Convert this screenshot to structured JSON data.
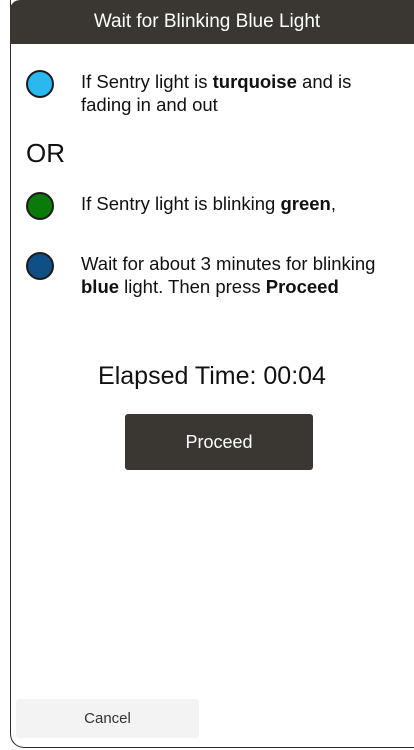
{
  "header": {
    "title": "Wait for Blinking Blue Light"
  },
  "options": [
    {
      "color": "#2bb8ee",
      "text_before": "If Sentry light is ",
      "text_bold": "turquoise",
      "text_after": " and is fading in and out"
    },
    {
      "color": "#0a7a0a",
      "text_before": "If Sentry light is blinking ",
      "text_bold": "green",
      "text_after": ","
    },
    {
      "color": "#0f4f85",
      "text_before": "Wait for about 3 minutes for blinking ",
      "text_bold": "blue",
      "text_after": " light. Then press ",
      "text_bold2": "Proceed"
    }
  ],
  "or_label": "OR",
  "elapsed": {
    "label": "Elapsed Time: 00:04"
  },
  "buttons": {
    "proceed": "Proceed",
    "cancel": "Cancel"
  },
  "colors": {
    "header_bg": "#3a3632",
    "button_bg": "#3a3632",
    "cancel_bg": "#f3f3f3"
  }
}
